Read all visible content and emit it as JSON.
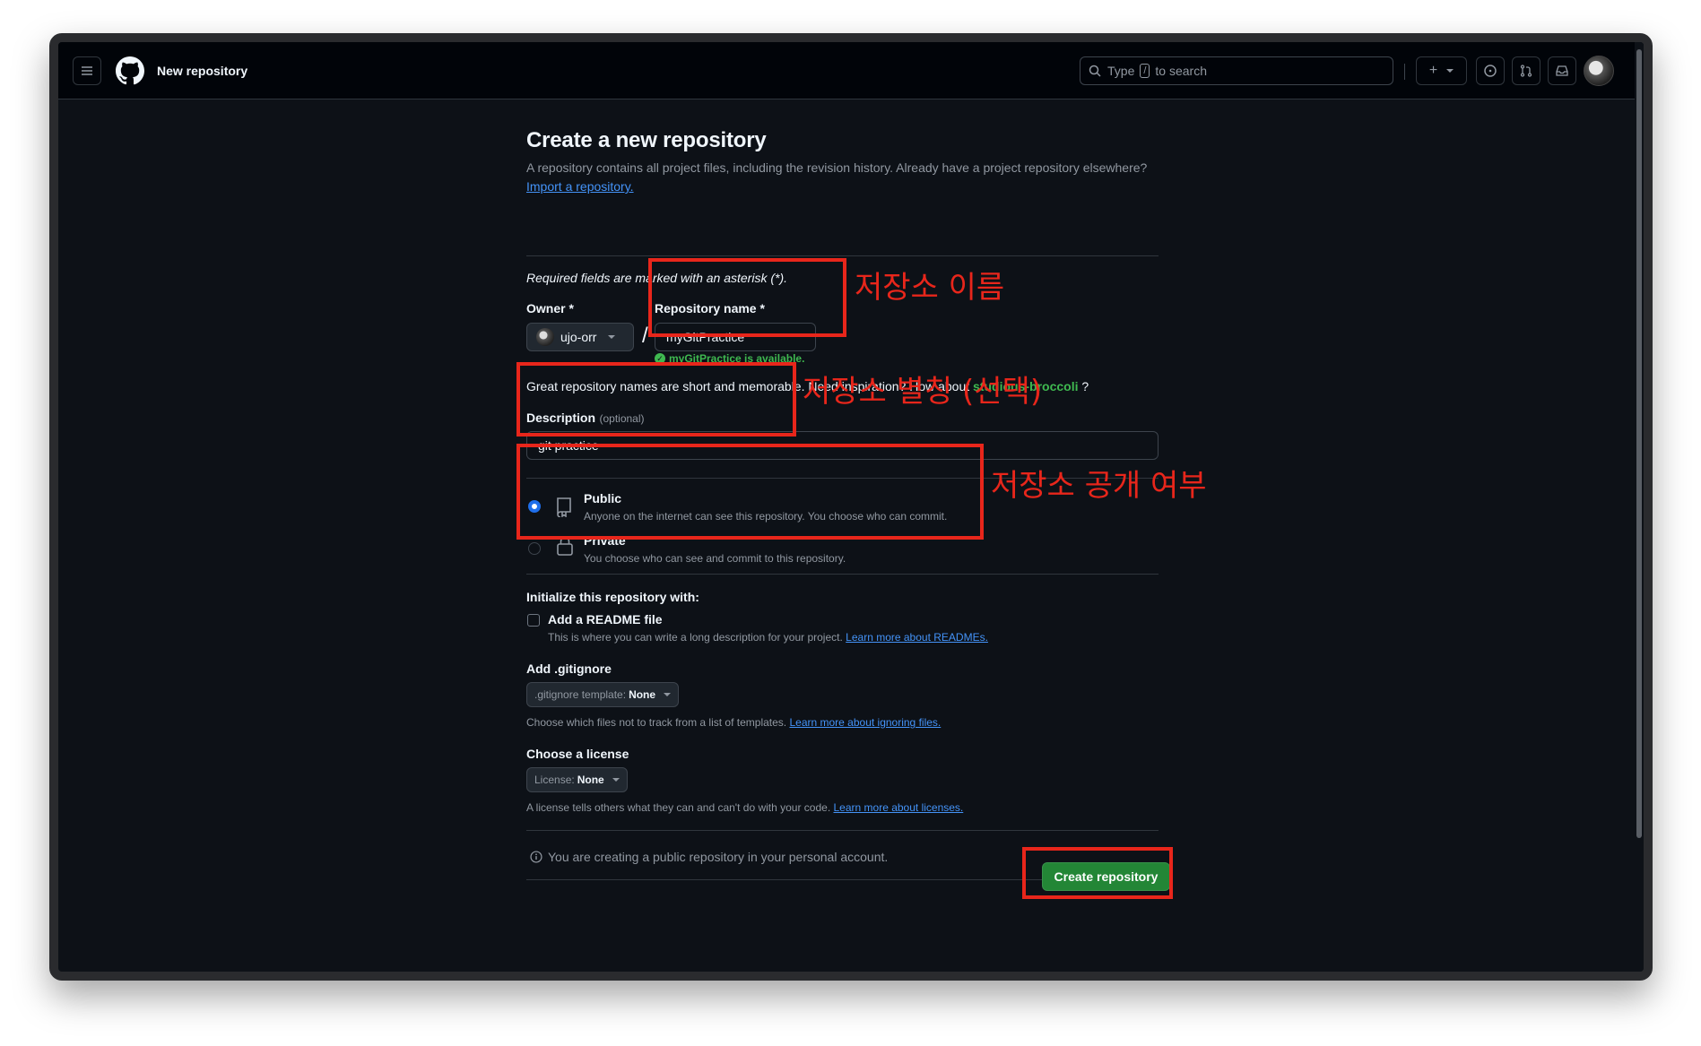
{
  "header": {
    "page_title": "New repository",
    "search": {
      "prefix": "Type",
      "key": "/",
      "suffix": "to search"
    },
    "icons": [
      "hamburger-icon",
      "github-logo",
      "search-icon",
      "plus-icon",
      "issues-icon",
      "pull-requests-icon",
      "inbox-icon",
      "avatar"
    ]
  },
  "form": {
    "title": "Create a new repository",
    "subtitle": "A repository contains all project files, including the revision history. Already have a project repository elsewhere?",
    "import_link": "Import a repository.",
    "required_note": "Required fields are marked with an asterisk (*).",
    "owner_label": "Owner *",
    "owner_value": "ujo-orr",
    "slash": "/",
    "repo_name_label": "Repository name *",
    "repo_name_value": "myGitPractice",
    "availability": "myGitPractice is available.",
    "inspiration_text": "Great repository names are short and memorable. Need inspiration? How about",
    "inspiration_name": "studious-broccoli",
    "inspiration_end": "?",
    "description_label": "Description",
    "description_optional": "(optional)",
    "description_value": "git practice",
    "visibility": [
      {
        "label": "Public",
        "desc": "Anyone on the internet can see this repository. You choose who can commit.",
        "selected": true
      },
      {
        "label": "Private",
        "desc": "You choose who can see and commit to this repository.",
        "selected": false
      }
    ],
    "init_heading": "Initialize this repository with:",
    "readme_label": "Add a README file",
    "readme_desc": "This is where you can write a long description for your project.",
    "readme_link": "Learn more about READMEs.",
    "gitignore_heading": "Add .gitignore",
    "gitignore_select_prefix": ".gitignore template:",
    "gitignore_select_value": "None",
    "gitignore_desc": "Choose which files not to track from a list of templates.",
    "gitignore_link": "Learn more about ignoring files.",
    "license_heading": "Choose a license",
    "license_select_prefix": "License:",
    "license_select_value": "None",
    "license_desc": "A license tells others what they can and can't do with your code.",
    "license_link": "Learn more about licenses.",
    "info_note": "You are creating a public repository in your personal account.",
    "create_button": "Create repository"
  },
  "annotations": {
    "repo_name": "저장소 이름",
    "description": "저장소 별칭 (선택)",
    "visibility": "저장소 공개 여부"
  },
  "colors": {
    "background": "#0d1117",
    "accent_green": "#238636",
    "link": "#4493f8",
    "annotation": "#e8261b"
  }
}
